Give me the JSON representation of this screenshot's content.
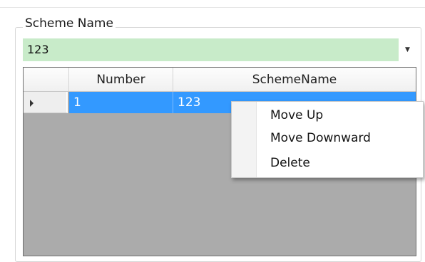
{
  "group": {
    "caption": "Scheme Name"
  },
  "combo": {
    "value": "123",
    "arrow_icon": "triangle-down-icon",
    "background_color": "#c8ebc9"
  },
  "grid": {
    "columns": [
      "Number",
      "SchemeName"
    ],
    "rows": [
      {
        "number": "1",
        "scheme_name": "123",
        "selected": true
      }
    ],
    "selection_color": "#3399ff",
    "empty_area_color": "#ababab"
  },
  "context_menu": {
    "items": [
      "Move Up",
      "Move Downward",
      "Delete"
    ]
  }
}
